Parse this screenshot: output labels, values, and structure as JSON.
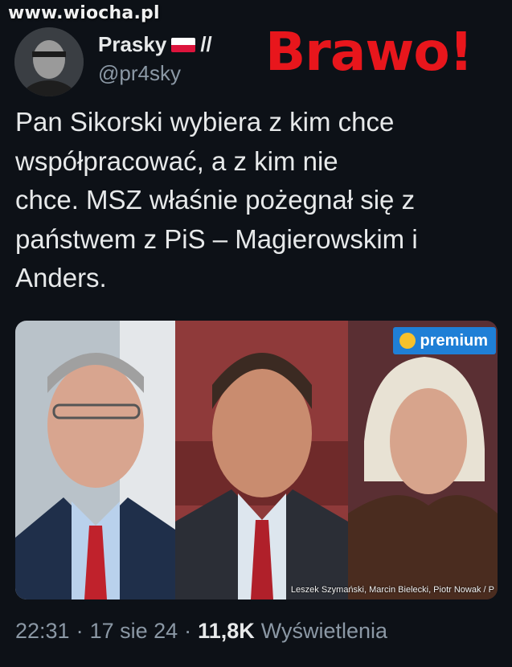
{
  "watermark": "www.wiocha.pl",
  "author": {
    "display_name": "Prasky",
    "name_suffix": "//",
    "handle": "@pr4sky"
  },
  "overlay_text": "Brawo!",
  "tweet": {
    "lines": [
      "Pan Sikorski wybiera z kim chce",
      "współpracować, a z kim nie",
      "chce. MSZ właśnie pożegnał się z",
      "państwem z PiS – Magierowskim i",
      "Anders."
    ]
  },
  "media": {
    "badge": "premium",
    "credit": "Leszek Szymański, Marcin Bielecki, Piotr Nowak / P"
  },
  "meta": {
    "time": "22:31",
    "date": "17 sie 24",
    "views_count": "11,8K",
    "views_label": "Wyświetlenia",
    "separator": "·"
  },
  "colors": {
    "background": "#0d1117",
    "text": "#e7e9ea",
    "secondary": "#8b98a5",
    "overlay": "#e8161c",
    "badge": "#1f7fd6"
  },
  "icons": [
    "poland-flag-icon",
    "premium-dot-icon"
  ]
}
